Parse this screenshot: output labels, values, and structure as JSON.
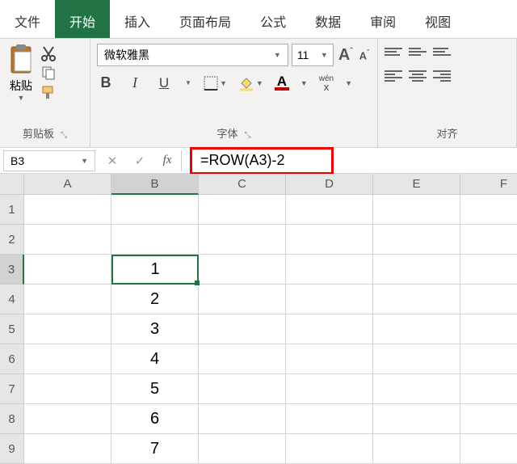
{
  "tabs": {
    "file": "文件",
    "home": "开始",
    "insert": "插入",
    "layout": "页面布局",
    "formula": "公式",
    "data": "数据",
    "review": "审阅",
    "view": "视图"
  },
  "clip": {
    "paste": "粘贴",
    "group": "剪贴板"
  },
  "font": {
    "name": "微软雅黑",
    "size": "11",
    "group": "字体",
    "bold": "B",
    "italic": "I",
    "underline": "U",
    "colorA": "A",
    "wen": "wén",
    "wenX": "x"
  },
  "align": {
    "group": "对齐"
  },
  "namebox": "B3",
  "formula": "=ROW(A3)-2",
  "cols": [
    "A",
    "B",
    "C",
    "D",
    "E",
    "F"
  ],
  "rows": [
    "1",
    "2",
    "3",
    "4",
    "5",
    "6",
    "7",
    "8",
    "9"
  ],
  "cells": {
    "B3": "1",
    "B4": "2",
    "B5": "3",
    "B6": "4",
    "B7": "5",
    "B8": "6",
    "B9": "7"
  },
  "chart_data": {
    "type": "table",
    "selected_cell": "B3",
    "formula": "=ROW(A3)-2",
    "columns": [
      "A",
      "B",
      "C",
      "D",
      "E",
      "F"
    ],
    "rows": [
      {
        "r": 1,
        "B": null
      },
      {
        "r": 2,
        "B": null
      },
      {
        "r": 3,
        "B": 1
      },
      {
        "r": 4,
        "B": 2
      },
      {
        "r": 5,
        "B": 3
      },
      {
        "r": 6,
        "B": 4
      },
      {
        "r": 7,
        "B": 5
      },
      {
        "r": 8,
        "B": 6
      },
      {
        "r": 9,
        "B": 7
      }
    ]
  }
}
